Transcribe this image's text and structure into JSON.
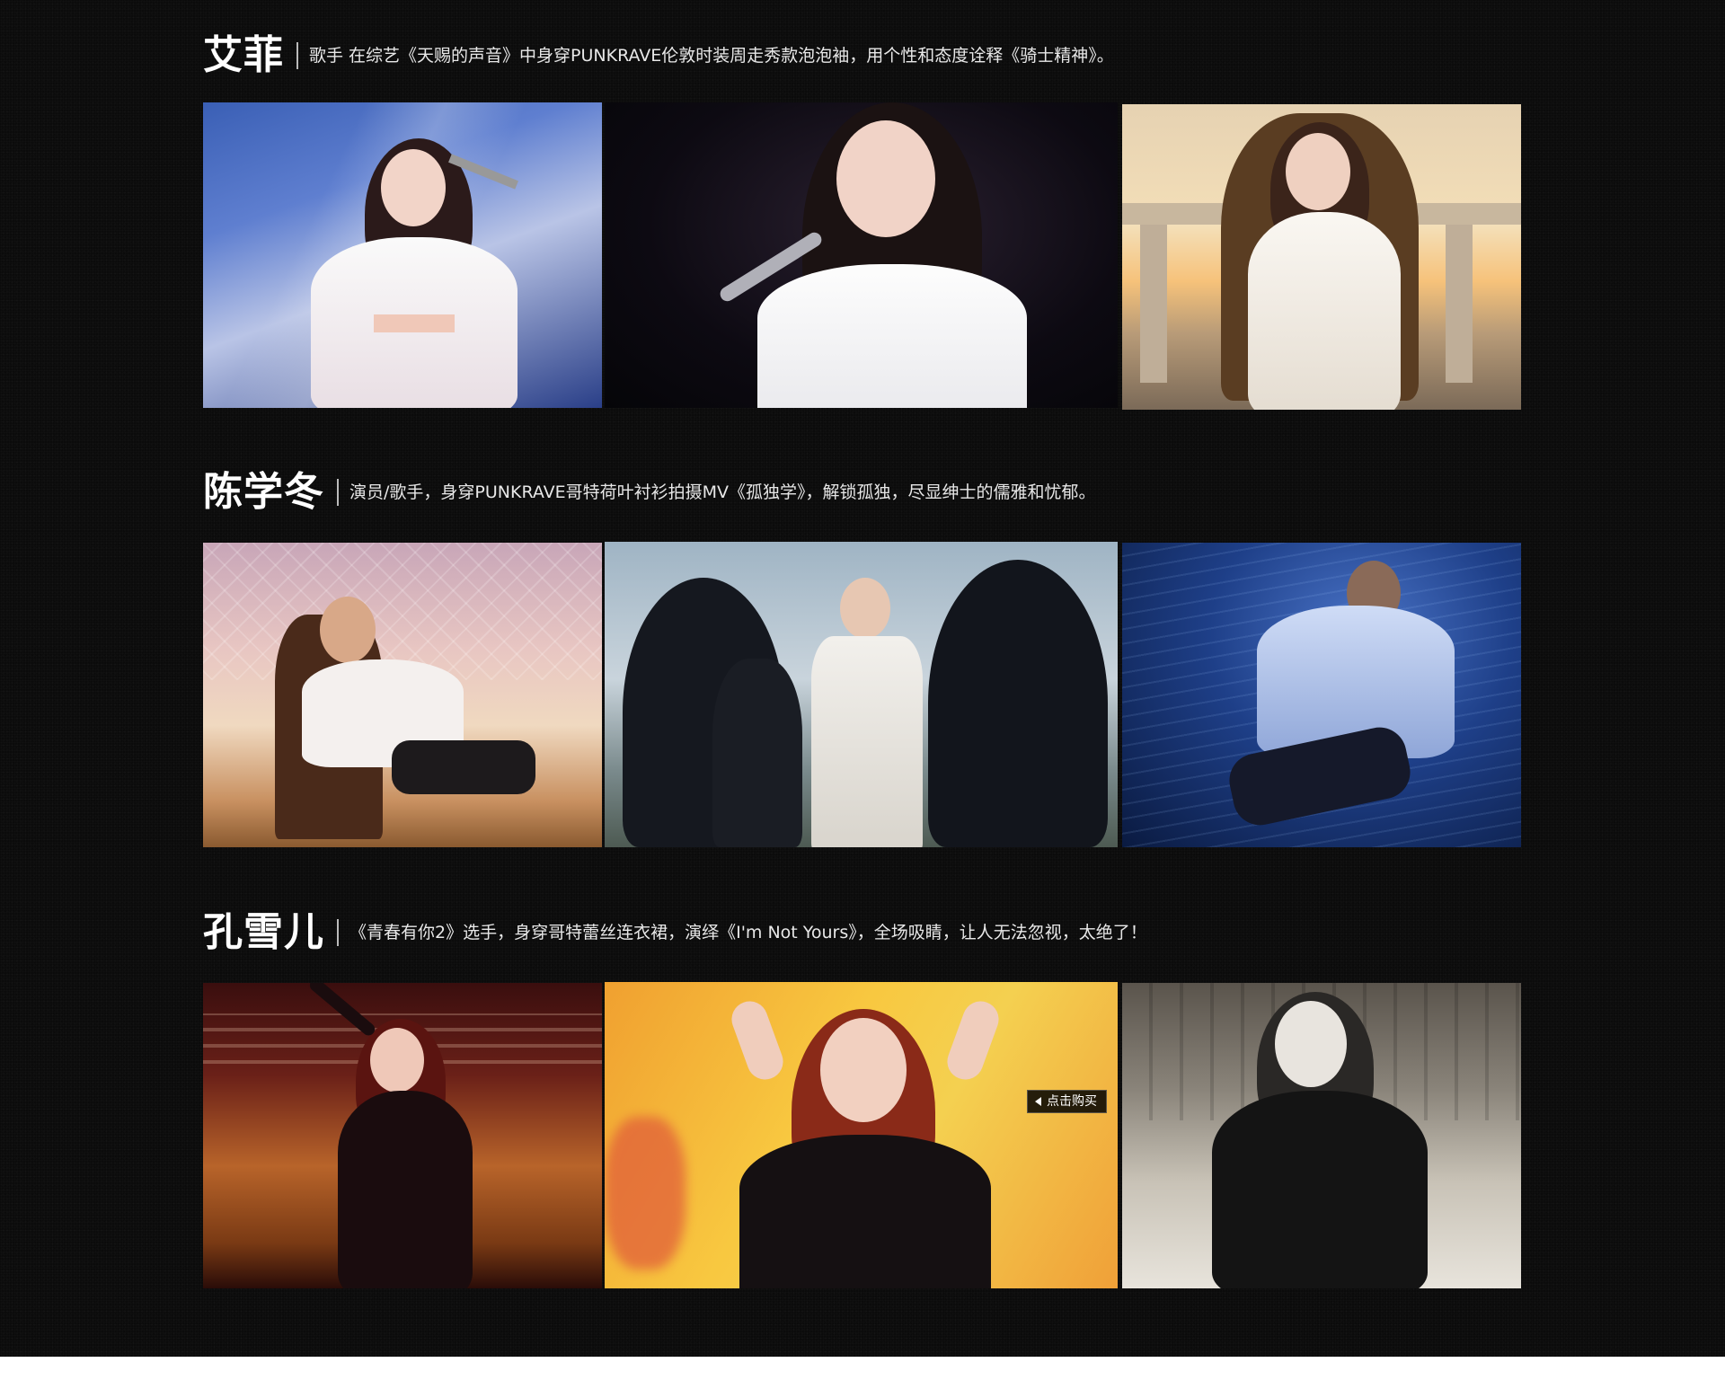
{
  "sections": [
    {
      "name": "艾菲",
      "description": "歌手  在综艺《天赐的声音》中身穿PUNKRAVE伦敦时装周走秀款泡泡袖，用个性和态度诠释《骑士精神》。",
      "photos": [
        {
          "alt": "艾菲 stage performance in white puff-sleeve outfit"
        },
        {
          "alt": "艾菲 close-up singing with microphone"
        },
        {
          "alt": "艾菲 seated on throne before sunset colonnade"
        }
      ]
    },
    {
      "name": "陈学冬",
      "description": "演员/歌手，身穿PUNKRAVE哥特荷叶衬衫拍摄MV《孤独学》，解锁孤独，尽显绅士的儒雅和忧郁。",
      "photos": [
        {
          "alt": "陈学冬 seated in ornate chair"
        },
        {
          "alt": "陈学冬 standing among hooded figures"
        },
        {
          "alt": "陈学冬 underwater in white shirt"
        }
      ]
    },
    {
      "name": "孔雪儿",
      "description": "《青春有你2》选手，身穿哥特蕾丝连衣裙，演绎《I'm Not Yours》，全场吸睛，让人无法忽视，太绝了！",
      "photos": [
        {
          "alt": "孔雪儿 dancing on stage in black lace dress"
        },
        {
          "alt": "孔雪儿 close-up with hand gestures"
        },
        {
          "alt": "孔雪儿 black and white performance shot"
        }
      ],
      "buy_label": "点击购买"
    }
  ]
}
